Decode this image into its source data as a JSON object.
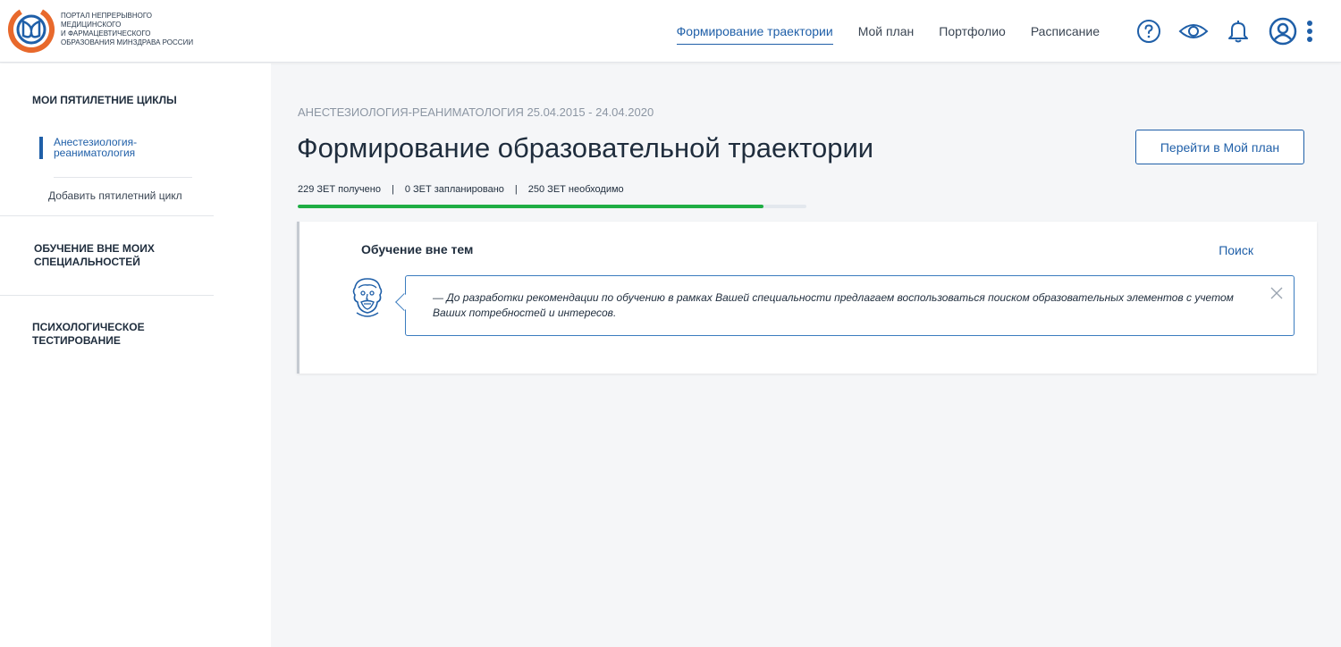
{
  "header": {
    "logo_lines": [
      "ПОРТАЛ НЕПРЕРЫВНОГО",
      "МЕДИЦИНСКОГО",
      "И ФАРМАЦЕВТИЧЕСКОГО",
      "ОБРАЗОВАНИЯ МИНЗДРАВА РОССИИ"
    ],
    "nav": [
      {
        "label": "Формирование траектории",
        "active": true
      },
      {
        "label": "Мой план"
      },
      {
        "label": "Портфолио"
      },
      {
        "label": "Расписание"
      }
    ],
    "icons": [
      "help-icon",
      "eye-icon",
      "bell-icon",
      "user-icon",
      "more-vertical-icon"
    ]
  },
  "sidebar": {
    "cycles_title": "МОИ ПЯТИЛЕТНИЕ ЦИКЛЫ",
    "active_cycle": "Анестезиология-реаниматология",
    "add_cycle": "Добавить пятилетний цикл",
    "outside_specialties": "ОБУЧЕНИЕ ВНЕ МОИХ СПЕЦИАЛЬНОСТЕЙ",
    "psych_testing": "ПСИХОЛОГИЧЕСКОЕ ТЕСТИРОВАНИЕ"
  },
  "main": {
    "breadcrumb": "АНЕСТЕЗИОЛОГИЯ-РЕАНИМАТОЛОГИЯ 25.04.2015 - 24.04.2020",
    "title": "Формирование образовательной траектории",
    "plan_button": "Перейти в Мой план",
    "stats": {
      "received": "229 ЗЕТ получено",
      "planned": "0 ЗЕТ запланировано",
      "required": "250 ЗЕТ необходимо",
      "separator": "|"
    },
    "progress_fraction": 0.916
  },
  "card": {
    "title": "Обучение вне тем",
    "search_link": "Поиск",
    "message": "— До разработки рекомендации по обучению в рамках Вашей специальности предлагаем воспользоваться поиском образовательных элементов с учетом Ваших потребностей и интересов."
  },
  "colors": {
    "accent": "#1f5fa8",
    "progress": "#1fae44",
    "logo_orange": "#e8692c",
    "logo_blue": "#1f5fa8"
  }
}
